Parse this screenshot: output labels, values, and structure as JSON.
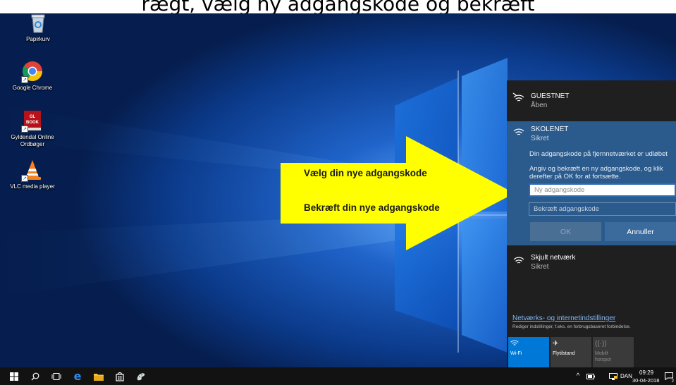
{
  "top_banner": {
    "text": "rægt, vælg ny adgangskode og bekræft"
  },
  "desktop": {
    "icons": [
      {
        "label": "Papirkurv",
        "icon": "recycle-bin-icon"
      },
      {
        "label": "Google Chrome",
        "icon": "chrome-icon"
      },
      {
        "label": "Gyldendal Online\nOrdbøger",
        "icon": "gyldendal-icon",
        "badge": "GL\nBOOK"
      },
      {
        "label": "VLC media player",
        "icon": "vlc-icon"
      }
    ]
  },
  "annotation": {
    "line1": "Vælg din nye adgangskode",
    "line2": "Bekræft din nye adgangskode",
    "arrow_color": "#ffff00"
  },
  "network_flyout": {
    "networks": [
      {
        "name": "GUESTNET",
        "status": "Åben"
      },
      {
        "name": "SKOLENET",
        "status": "Sikret"
      },
      {
        "name": "Skjult netværk",
        "status": "Sikret"
      }
    ],
    "message_line1": "Din adgangskode på fjernnetværket er udløbet",
    "message_line2": "Angiv og bekræft en ny adgangskode, og klik",
    "message_line3": "derefter på OK for at fortsætte.",
    "new_password_placeholder": "Ny adgangskode",
    "confirm_password_placeholder": "Bekræft adgangskode",
    "ok_label": "OK",
    "cancel_label": "Annuller",
    "settings_link": "Netværks- og internetindstillinger",
    "settings_desc": "Rediger indstillinger, f.eks. en forbrugsbaseret forbindelse.",
    "quick_actions": [
      {
        "label": "Wi-Fi",
        "icon": "wifi-icon",
        "active": true
      },
      {
        "label": "Flytilstand",
        "icon": "airplane-icon",
        "active": false
      },
      {
        "label": "Mobilt\nhotspot",
        "icon": "hotspot-icon",
        "active": false,
        "disabled": true
      }
    ],
    "colors": {
      "panel_bg": "#1f1f1f",
      "selected_bg": "#2b5a8c",
      "accent": "#0078d7"
    }
  },
  "taskbar": {
    "language": "DAN",
    "time": "09:29",
    "date": "30-04-2018",
    "notification_count": "2"
  }
}
